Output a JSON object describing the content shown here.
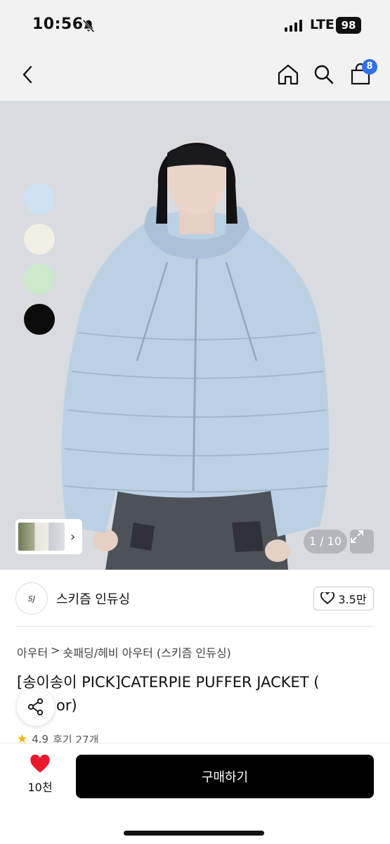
{
  "status": {
    "time": "10:56",
    "network": "LTE",
    "battery": "98"
  },
  "nav": {
    "cart_count": "8"
  },
  "hero": {
    "swatch_colors": [
      "#cfe2f3",
      "#f2efe4",
      "#cce9cb",
      "#0c0c0c"
    ],
    "counter": "1 / 10",
    "jacket_color": "#bcd0e3"
  },
  "brand": {
    "logo_text": "SJ",
    "name": "스키즘 인듀싱",
    "likes": "3.5만"
  },
  "product": {
    "breadcrumb": [
      "아우터",
      ">",
      "숏패딩/헤비 아우터 (스키즘 인듀싱)"
    ],
    "title": "[송이송이 PICK]CATERPIE PUFFER JACKET (",
    "title_line2": "or)",
    "rating": "4.9",
    "reviews": "후기 27개"
  },
  "bottom": {
    "wish_count": "10천",
    "buy_label": "구매하기"
  }
}
